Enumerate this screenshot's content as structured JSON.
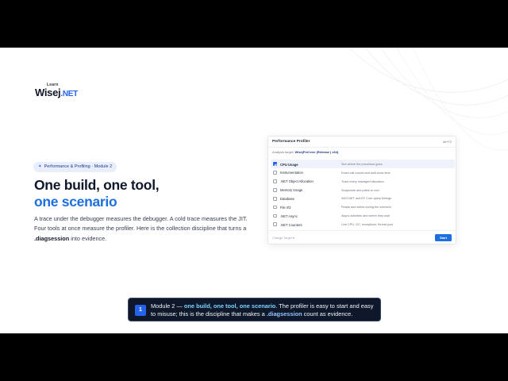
{
  "logo": {
    "learn": "Learn",
    "name": "Wisej",
    "suffix": ".NET"
  },
  "module_pill": {
    "icon": "sparkle-icon",
    "label": "Performance & Profiling · Module 2"
  },
  "headline": {
    "line1": "One build, one tool,",
    "line2": "one scenario"
  },
  "intro": {
    "part1": "A trace under the debugger measures the debugger. A cold trace measures the JIT. Four tools at once measure the profiler. Here is the collection discipline that turns a ",
    "bold": ".diagsession",
    "part2": " into evidence."
  },
  "profiler": {
    "title": "Performance Profiler",
    "meta": "Alt+F2",
    "target_label": "Analysis target:",
    "target_value": "WisejPerf.exe (Release | x64)",
    "tools": [
      {
        "name": "CPU Usage",
        "desc": "See where the processor goes",
        "checked": true
      },
      {
        "name": "Instrumentation",
        "desc": "Exact call counts and wall-clock time",
        "checked": false
      },
      {
        "name": ".NET Object Allocation",
        "desc": "Track every managed allocation",
        "checked": false
      },
      {
        "name": "Memory Usage",
        "desc": "Snapshots and paths to root",
        "checked": false
      },
      {
        "name": "Database",
        "desc": "ADO.NET and EF Core query timings",
        "checked": false
      },
      {
        "name": "File I/O",
        "desc": "Reads and writes during the scenario",
        "checked": false
      },
      {
        "name": ".NET Async",
        "desc": "Async activities and where they wait",
        "checked": false
      },
      {
        "name": ".NET Counters",
        "desc": "Live CPU, GC, exceptions, thread pool",
        "checked": false
      }
    ],
    "change_target": "Change Target ▾",
    "start_label": "Start"
  },
  "caption": {
    "badge": "1",
    "prefix": "Module 2 — ",
    "highlight": "one build, one tool, one scenario",
    "middle": ". The profiler is easy to start and easy to misuse; this is the discipline that makes a ",
    "highlight2": ".diagsession",
    "suffix": " count as evidence."
  },
  "colors": {
    "accent": "#1d6fe0",
    "caption_bg": "#0f172a",
    "pill_bg": "#e8eefb"
  }
}
